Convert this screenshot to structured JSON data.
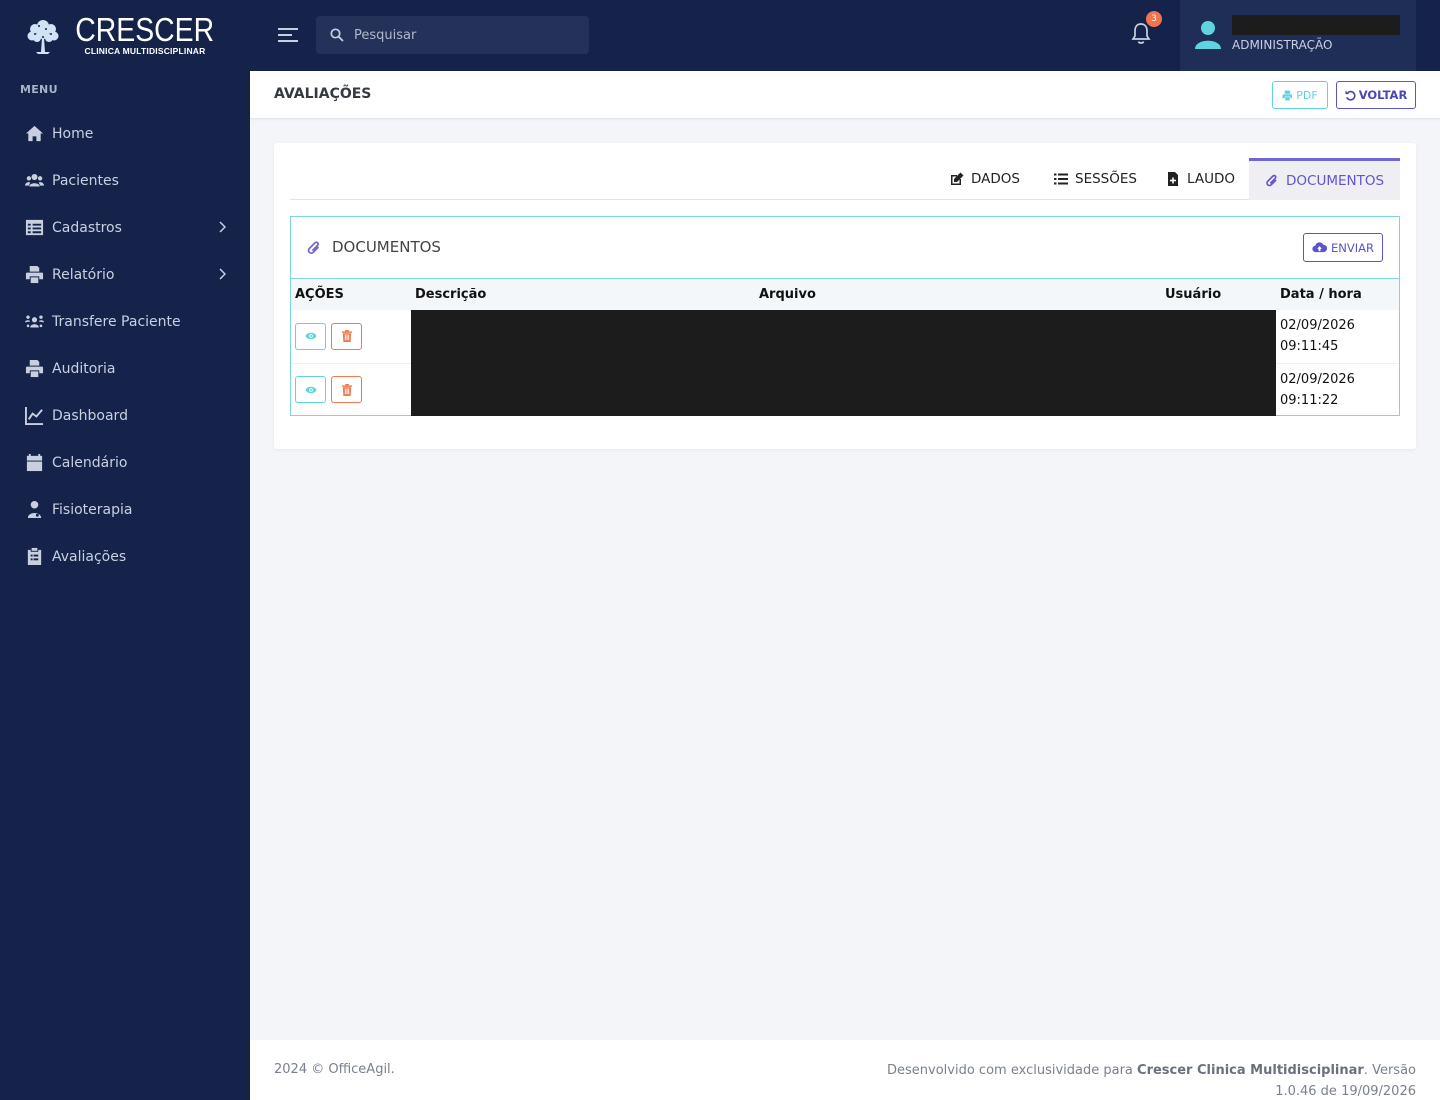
{
  "brand": {
    "name": "CRESCER",
    "subtitle": "CLINICA MULTIDISCIPLINAR"
  },
  "sidebar": {
    "menu_title": "MENU",
    "items": [
      {
        "label": "Home",
        "icon": "home-icon"
      },
      {
        "label": "Pacientes",
        "icon": "users-icon"
      },
      {
        "label": "Cadastros",
        "icon": "table-icon",
        "submenu": true
      },
      {
        "label": "Relatório",
        "icon": "printer-icon",
        "submenu": true
      },
      {
        "label": "Transfere Paciente",
        "icon": "people-transfer-icon"
      },
      {
        "label": "Auditoria",
        "icon": "printer-icon"
      },
      {
        "label": "Dashboard",
        "icon": "line-chart-icon"
      },
      {
        "label": "Calendário",
        "icon": "calendar-icon"
      },
      {
        "label": "Fisioterapia",
        "icon": "user-doctor-icon"
      },
      {
        "label": "Avaliações",
        "icon": "clipboard-icon"
      }
    ]
  },
  "topbar": {
    "search_placeholder": "Pesquisar",
    "notifications_count": "3",
    "user_role": "ADMINISTRAÇÃO"
  },
  "page": {
    "title": "AVALIAÇÕES",
    "pdf_label": "PDF",
    "voltar_label": "VOLTAR"
  },
  "tabs": [
    {
      "label": "DADOS",
      "icon": "edit-icon"
    },
    {
      "label": "SESSÕES",
      "icon": "list-icon"
    },
    {
      "label": "LAUDO",
      "icon": "file-plus-icon"
    },
    {
      "label": "DOCUMENTOS",
      "icon": "paperclip-icon",
      "active": true
    }
  ],
  "documents": {
    "title": "DOCUMENTOS",
    "send_label": "ENVIAR",
    "columns": [
      "AÇÕES",
      "Descrição",
      "Arquivo",
      "Usuário",
      "Data / hora"
    ],
    "rows": [
      {
        "date": "02/09/2026",
        "time": "09:11:45"
      },
      {
        "date": "02/09/2026",
        "time": "09:11:22"
      }
    ]
  },
  "footer": {
    "left": "2024 © OfficeAgil.",
    "right_prefix": "Desenvolvido com exclusividade para ",
    "right_company": "Crescer Clinica Multidisciplinar",
    "right_suffix": ". Versão 1.0.46 de 19/09/2026"
  },
  "colors": {
    "sidebar_bg": "#15234a",
    "accent_purple": "#6055cc",
    "accent_cyan": "#5fd3e0",
    "danger_orange": "#ef7a4e"
  }
}
